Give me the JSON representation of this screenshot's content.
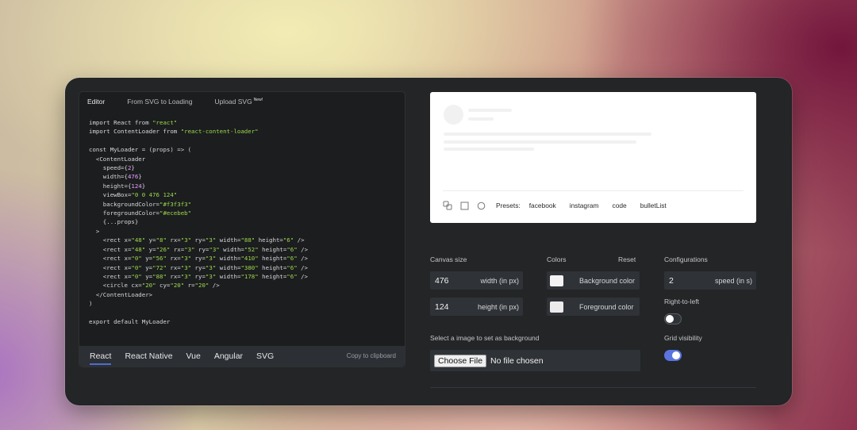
{
  "editor": {
    "tabs": [
      "Editor",
      "From SVG to Loading",
      "Upload SVG"
    ],
    "new_badge": "New!",
    "code": {
      "l1a": "import React from ",
      "l1b": "\"react\"",
      "l2a": "import ContentLoader from ",
      "l2b": "\"react-content-loader\"",
      "l4": "const MyLoader = (props) => (",
      "l5": "  <ContentLoader",
      "speed_a": "    speed={",
      "speed_v": "2",
      "speed_c": "}",
      "width_a": "    width={",
      "width_v": "476",
      "width_c": "}",
      "height_a": "    height={",
      "height_v": "124",
      "height_c": "}",
      "vb_a": "    viewBox=",
      "vb_v": "\"0 0 476 124\"",
      "bg_a": "    backgroundColor=",
      "bg_v": "\"#f3f3f3\"",
      "fg_a": "    foregroundColor=",
      "fg_v": "\"#ecebeb\"",
      "props": "    {...props}",
      "close": "  >",
      "r1a": "    <rect x=",
      "r1b": "\"48\"",
      "r1c": " y=",
      "r1d": "\"8\"",
      "r1e": " rx=",
      "r1f": "\"3\"",
      "r1g": " ry=",
      "r1h": "\"3\"",
      "r1i": " width=",
      "r1j": "\"88\"",
      "r1k": " height=",
      "r1l": "\"6\"",
      "r1m": " />",
      "r2a": "    <rect x=",
      "r2b": "\"48\"",
      "r2c": " y=",
      "r2d": "\"26\"",
      "r2e": " rx=",
      "r2f": "\"3\"",
      "r2g": " ry=",
      "r2h": "\"3\"",
      "r2i": " width=",
      "r2j": "\"52\"",
      "r2k": " height=",
      "r2l": "\"6\"",
      "r2m": " />",
      "r3a": "    <rect x=",
      "r3b": "\"0\"",
      "r3c": " y=",
      "r3d": "\"56\"",
      "r3e": " rx=",
      "r3f": "\"3\"",
      "r3g": " ry=",
      "r3h": "\"3\"",
      "r3i": " width=",
      "r3j": "\"410\"",
      "r3k": " height=",
      "r3l": "\"6\"",
      "r3m": " />",
      "r4a": "    <rect x=",
      "r4b": "\"0\"",
      "r4c": " y=",
      "r4d": "\"72\"",
      "r4e": " rx=",
      "r4f": "\"3\"",
      "r4g": " ry=",
      "r4h": "\"3\"",
      "r4i": " width=",
      "r4j": "\"380\"",
      "r4k": " height=",
      "r4l": "\"6\"",
      "r4m": " />",
      "r5a": "    <rect x=",
      "r5b": "\"0\"",
      "r5c": " y=",
      "r5d": "\"88\"",
      "r5e": " rx=",
      "r5f": "\"3\"",
      "r5g": " ry=",
      "r5h": "\"3\"",
      "r5i": " width=",
      "r5j": "\"178\"",
      "r5k": " height=",
      "r5l": "\"6\"",
      "r5m": " />",
      "c1a": "    <circle cx=",
      "c1b": "\"20\"",
      "c1c": " cy=",
      "c1d": "\"20\"",
      "c1e": " r=",
      "c1f": "\"20\"",
      "c1g": " />",
      "endtag": "  </ContentLoader>",
      "paren": ")",
      "export": "export default MyLoader"
    },
    "languages": [
      "React",
      "React Native",
      "Vue",
      "Angular",
      "SVG"
    ],
    "active_language": "React",
    "copy_label": "Copy to clipboard"
  },
  "preview": {
    "presets_label": "Presets:",
    "presets": [
      "facebook",
      "instagram",
      "code",
      "bulletList"
    ]
  },
  "settings": {
    "canvas_size_label": "Canvas size",
    "width_value": "476",
    "width_unit": "width (in px)",
    "height_value": "124",
    "height_unit": "height (in px)",
    "colors_label": "Colors",
    "reset_label": "Reset",
    "background_color_label": "Background color",
    "foreground_color_label": "Foreground color",
    "background_color": "#f3f3f3",
    "foreground_color": "#ecebeb",
    "configurations_label": "Configurations",
    "speed_value": "2",
    "speed_unit": "speed (in s)",
    "rtl_label": "Right-to-left",
    "rtl_enabled": false,
    "grid_label": "Grid visibility",
    "grid_enabled": true,
    "bg_image_label": "Select a image to set as background",
    "choose_file_label": "Choose File",
    "no_file_label": "No file chosen",
    "accent_color": "#5b74e0"
  }
}
